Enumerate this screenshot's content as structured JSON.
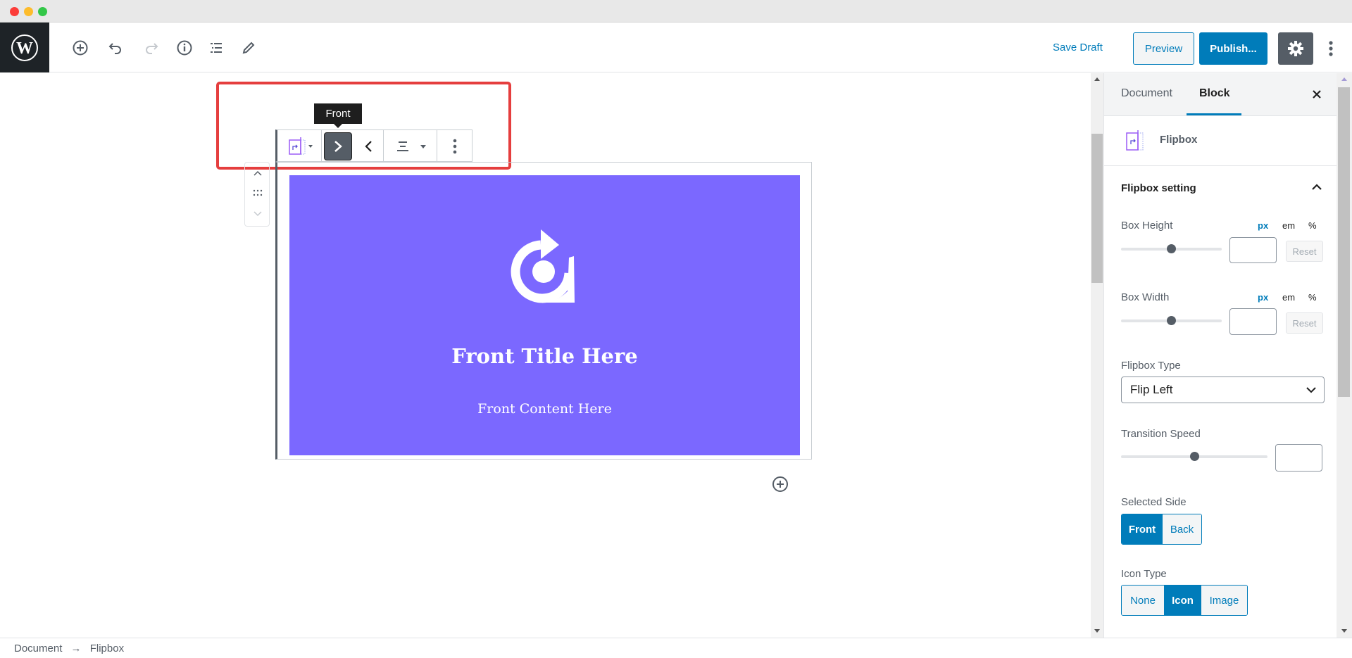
{
  "window": {
    "controls": [
      "close",
      "minimize",
      "maximize"
    ],
    "colors": {
      "close": "#fc3d39",
      "minimize": "#fdbc2c",
      "maximize": "#33c748"
    }
  },
  "header": {
    "logo": "wordpress-logo",
    "tools": [
      "add-block-icon",
      "undo-icon",
      "redo-icon",
      "info-icon",
      "list-view-icon",
      "edit-pencil-icon"
    ],
    "save_draft": "Save Draft",
    "preview": "Preview",
    "publish": "Publish...",
    "settings_icon": "gear-icon",
    "more_icon": "vertical-dots-icon"
  },
  "block_toolbar": {
    "tooltip": "Front",
    "buttons": [
      "flipbox-block-icon",
      "front-side-icon",
      "back-side-icon",
      "align-icon",
      "more-options-icon"
    ],
    "highlight_color": "#e53e3e"
  },
  "block": {
    "background": "#7b68ff",
    "icon": "rotate-circle-icon",
    "title": "Front Title Here",
    "content": "Front Content Here"
  },
  "sidebar": {
    "tabs": [
      {
        "label": "Document",
        "active": false
      },
      {
        "label": "Block",
        "active": true
      }
    ],
    "block_name": "Flipbox",
    "panel_title": "Flipbox setting",
    "box_height": {
      "label": "Box Height",
      "units": [
        "px",
        "em",
        "%"
      ],
      "active_unit": "px",
      "slider": 0.5,
      "value": "",
      "reset": "Reset"
    },
    "box_width": {
      "label": "Box Width",
      "units": [
        "px",
        "em",
        "%"
      ],
      "active_unit": "px",
      "slider": 0.5,
      "value": "",
      "reset": "Reset"
    },
    "flipbox_type": {
      "label": "Flipbox Type",
      "value": "Flip Left"
    },
    "transition_speed": {
      "label": "Transition Speed",
      "slider": 0.5,
      "value": ""
    },
    "selected_side": {
      "label": "Selected Side",
      "options": [
        "Front",
        "Back"
      ],
      "selected": "Front"
    },
    "icon_type": {
      "label": "Icon Type",
      "options": [
        "None",
        "Icon",
        "Image"
      ],
      "selected": "Icon"
    }
  },
  "footer": {
    "breadcrumb": [
      "Document",
      "Flipbox"
    ],
    "separator": "→"
  },
  "accent": "#007cba"
}
